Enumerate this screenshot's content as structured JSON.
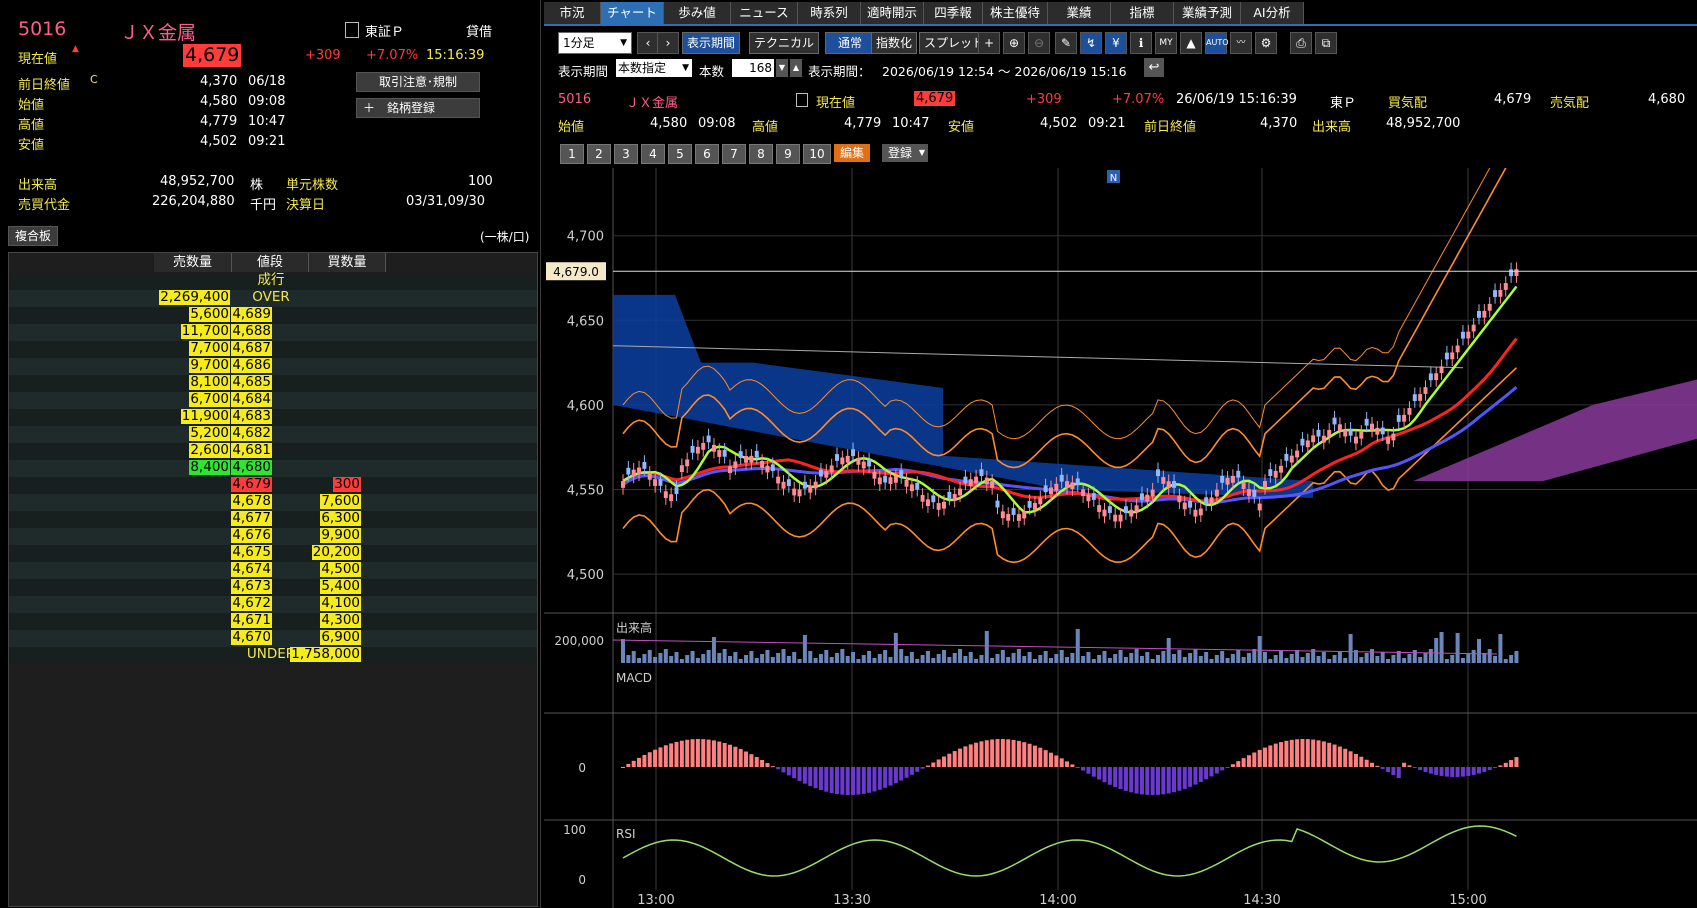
{
  "stock": {
    "code": "5016",
    "name": "ＪＸ金属",
    "market": "東証Ｐ",
    "lending": "貸借",
    "current_label": "現在値",
    "current_price": "4,679",
    "change": "+309",
    "change_pct": "+7.07%",
    "time": "15:16:39",
    "rows": [
      {
        "label": "前日終値",
        "flag": "C",
        "value": "4,370",
        "time": "06/18"
      },
      {
        "label": "始値",
        "flag": "",
        "value": "4,580",
        "time": "09:08"
      },
      {
        "label": "高値",
        "flag": "",
        "value": "4,779",
        "time": "10:47"
      },
      {
        "label": "安値",
        "flag": "",
        "value": "4,502",
        "time": "09:21"
      }
    ],
    "volume_label": "出来高",
    "volume": "48,952,700",
    "volume_unit": "株",
    "unit_shares_label": "単元株数",
    "unit_shares": "100",
    "turnover_label": "売買代金",
    "turnover": "226,204,880",
    "turnover_unit": "千円",
    "settle_label": "決算日",
    "settle": "03/31,09/30",
    "btn_notice": "取引注意･規制",
    "btn_register": "＋　銘柄登録",
    "btn_combo": "複合板",
    "unit_note": "(一株/口)"
  },
  "book": {
    "headers": [
      "売数量",
      "値段",
      "買数量"
    ],
    "market_label": "成行",
    "asks": [
      {
        "qty": "2,269,400",
        "price": "OVER"
      },
      {
        "qty": "5,600",
        "price": "4,689"
      },
      {
        "qty": "11,700",
        "price": "4,688"
      },
      {
        "qty": "7,700",
        "price": "4,687"
      },
      {
        "qty": "9,700",
        "price": "4,686"
      },
      {
        "qty": "8,100",
        "price": "4,685"
      },
      {
        "qty": "6,700",
        "price": "4,684"
      },
      {
        "qty": "11,900",
        "price": "4,683"
      },
      {
        "qty": "5,200",
        "price": "4,682"
      },
      {
        "qty": "2,600",
        "price": "4,681"
      },
      {
        "qty": "8,400",
        "price": "4,680"
      }
    ],
    "bids": [
      {
        "price": "4,679",
        "qty": "300"
      },
      {
        "price": "4,678",
        "qty": "7,600"
      },
      {
        "price": "4,677",
        "qty": "6,300"
      },
      {
        "price": "4,676",
        "qty": "9,900"
      },
      {
        "price": "4,675",
        "qty": "20,200"
      },
      {
        "price": "4,674",
        "qty": "4,500"
      },
      {
        "price": "4,673",
        "qty": "5,400"
      },
      {
        "price": "4,672",
        "qty": "4,100"
      },
      {
        "price": "4,671",
        "qty": "4,300"
      },
      {
        "price": "4,670",
        "qty": "6,900"
      },
      {
        "price": "UNDER",
        "qty": "1,758,000"
      }
    ]
  },
  "tabs": [
    "市況",
    "チャート",
    "歩み値",
    "ニュース",
    "時系列",
    "適時開示",
    "四季報",
    "株主優待",
    "業績",
    "指標",
    "業績予測",
    "AI分析"
  ],
  "active_tab": "チャート",
  "toolbar": {
    "period_select": "1分足",
    "display_period_btn": "表示期間",
    "technical_btn": "テクニカル",
    "normal_btn": "通常",
    "index_btn": "指数化",
    "spread_btn": "スプレッド",
    "period_label": "表示期間",
    "count_select": "本数指定",
    "count_label": "本数",
    "count_value": "168",
    "range_label": "表示期間：",
    "range_value": "2026/06/19 12:54 ～ 2026/06/19 15:16",
    "edit_btn": "編集",
    "register_btn": "登録",
    "number_buttons": [
      "1",
      "2",
      "3",
      "4",
      "5",
      "6",
      "7",
      "8",
      "9",
      "10"
    ]
  },
  "quote": {
    "code": "5016",
    "name": "ＪＸ金属",
    "current_label": "現在値",
    "current": "4,679",
    "change": "+309",
    "change_pct": "+7.07%",
    "datetime": "26/06/19 15:16:39",
    "market": "東Ｐ",
    "buy_label": "買気配",
    "buy": "4,679",
    "sell_label": "売気配",
    "sell": "4,680",
    "open_label": "始値",
    "open": "4,580",
    "open_time": "09:08",
    "high_label": "高値",
    "high": "4,779",
    "high_time": "10:47",
    "low_label": "安値",
    "low": "4,502",
    "low_time": "09:21",
    "prev_label": "前日終値",
    "prev": "4,370",
    "vol_label": "出来高",
    "vol": "48,952,700"
  },
  "chart_data": {
    "type": "line",
    "price_axis": {
      "min": 4480,
      "max": 4740,
      "ticks": [
        "4,700",
        "4,650",
        "4,600",
        "4,550",
        "4,500"
      ]
    },
    "current_tag": "4,679.0",
    "news_marker": "N",
    "time_ticks": [
      "13:00",
      "13:30",
      "14:00",
      "14:30",
      "15:00"
    ],
    "volume_label": "出来高",
    "volume_tick": "200,000",
    "macd_label": "MACD",
    "macd_tick": "0",
    "rsi_label": "RSI",
    "rsi_tick": "100",
    "rsi_tick_low": "0",
    "colors": {
      "up_candle": "#ff8c94",
      "down_candle": "#8fb8ff",
      "ma_short": "#aaff33",
      "ma_mid": "#ff2222",
      "ma_long": "#5555ff",
      "bollinger": "#ff8c2a",
      "cloud": "#0a3fa0",
      "cloud2": "#8a3a9a",
      "macd_pos": "#ff8080",
      "macd_neg": "#6a3ad0",
      "rsi": "#99dd66"
    }
  }
}
